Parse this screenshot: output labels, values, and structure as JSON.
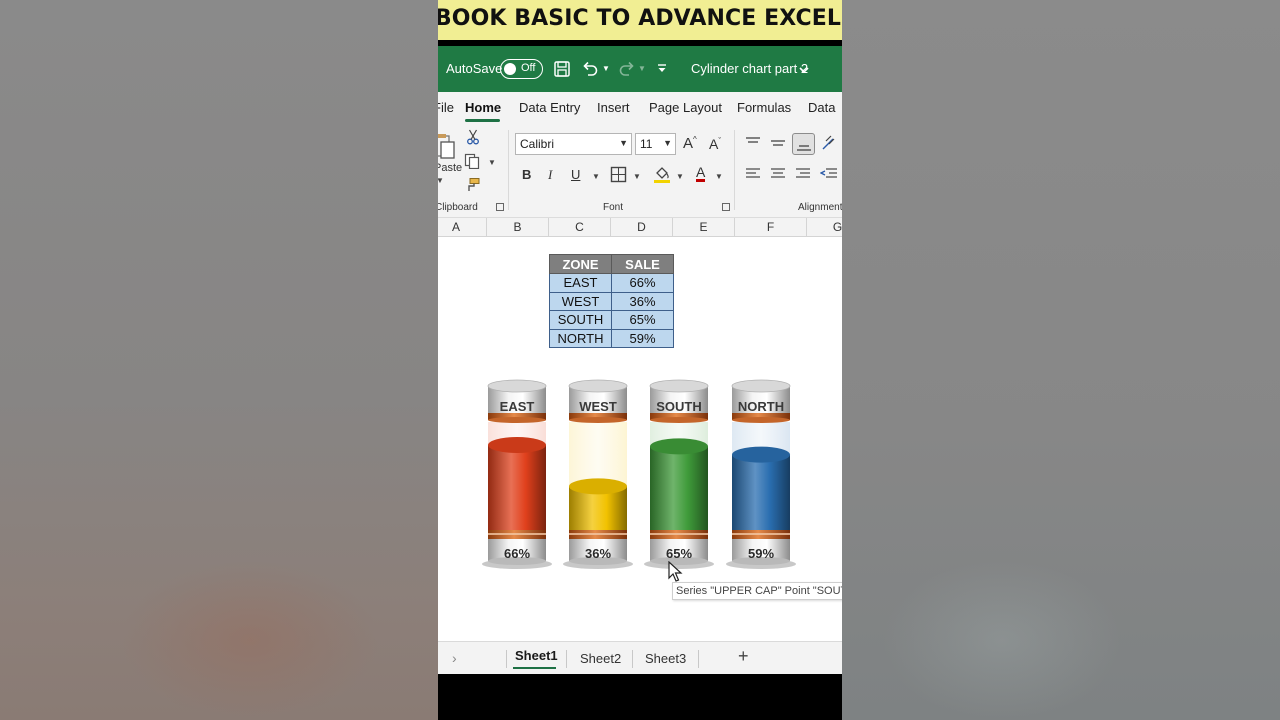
{
  "banner": {
    "text": "& BOOK BASIC TO ADVANCE EXCEL"
  },
  "titlebar": {
    "autosave_label": "AutoSave",
    "autosave_state": "Off",
    "document_title": "Cylinder chart part 2"
  },
  "ribbon_tabs": [
    "File",
    "Home",
    "Data Entry",
    "Insert",
    "Page Layout",
    "Formulas",
    "Data"
  ],
  "ribbon": {
    "clipboard": {
      "paste_label": "Paste",
      "group_label": "Clipboard"
    },
    "font": {
      "font_name": "Calibri",
      "font_size": "11",
      "grow_font": "A^",
      "shrink_font": "A˅",
      "bold": "B",
      "italic": "I",
      "underline": "U",
      "font_color": "A",
      "group_label": "Font"
    },
    "alignment": {
      "group_label": "Alignment"
    }
  },
  "columns": [
    "A",
    "B",
    "C",
    "D",
    "E",
    "F",
    "G"
  ],
  "table": {
    "headers": [
      "ZONE",
      "SALE"
    ],
    "rows": [
      [
        "EAST",
        "66%"
      ],
      [
        "WEST",
        "36%"
      ],
      [
        "SOUTH",
        "65%"
      ],
      [
        "NORTH",
        "59%"
      ]
    ]
  },
  "chart_data": {
    "type": "bar",
    "title": "",
    "categories": [
      "EAST",
      "WEST",
      "SOUTH",
      "NORTH"
    ],
    "values": [
      66,
      36,
      65,
      59
    ],
    "value_labels": [
      "66%",
      "36%",
      "65%",
      "59%"
    ],
    "ylim": [
      0,
      100
    ],
    "colors": [
      "#e0401c",
      "#f2c200",
      "#3f9b3a",
      "#2a6eb0"
    ],
    "legend": "none",
    "grid": false
  },
  "tooltip": {
    "text": "Series \"UPPER CAP\" Point \"SOUTH\""
  },
  "sheet_tabs": [
    "Sheet1",
    "Sheet2",
    "Sheet3"
  ],
  "active_sheet": "Sheet1",
  "colors": {
    "excel_green": "#1f7a44",
    "banner_yellow": "#f1ee93",
    "table_header": "#7f7f7f",
    "table_cell": "#bdd7ee"
  }
}
